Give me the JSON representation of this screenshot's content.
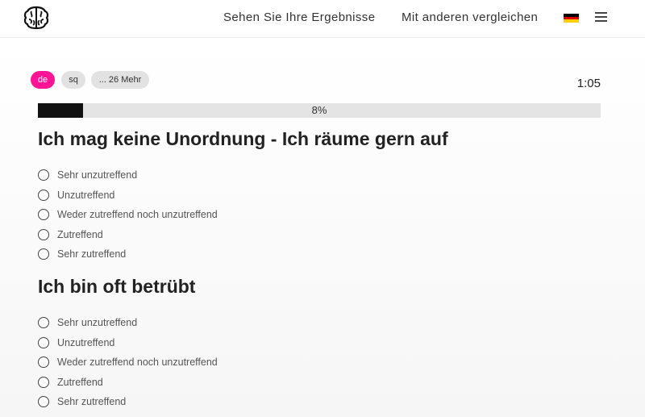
{
  "header": {
    "logo": "brain-logo-icon",
    "nav": {
      "results": "Sehen Sie Ihre Ergebnisse",
      "compare": "Mit anderen vergleichen"
    },
    "flag": "german-flag-icon",
    "menu": "hamburger-menu-icon"
  },
  "languages": {
    "active": "de",
    "second": "sq",
    "more": "... 26 Mehr"
  },
  "timer": "1:05",
  "progress": {
    "value": 0.08,
    "label": "8%"
  },
  "questions": [
    {
      "text": "Ich mag keine Unordnung - Ich räume gern auf",
      "options": [
        "Sehr unzutreffend",
        "Unzutreffend",
        "Weder zutreffend noch unzutreffend",
        "Zutreffend",
        "Sehr zutreffend"
      ]
    },
    {
      "text": "Ich bin oft betrübt",
      "options": [
        "Sehr unzutreffend",
        "Unzutreffend",
        "Weder zutreffend noch unzutreffend",
        "Zutreffend",
        "Sehr zutreffend"
      ]
    }
  ],
  "colors": {
    "accent": "#ff1493",
    "progress_fill": "#111111",
    "progress_track": "#e4e4e4",
    "chip_inactive": "#e2e2e2"
  }
}
